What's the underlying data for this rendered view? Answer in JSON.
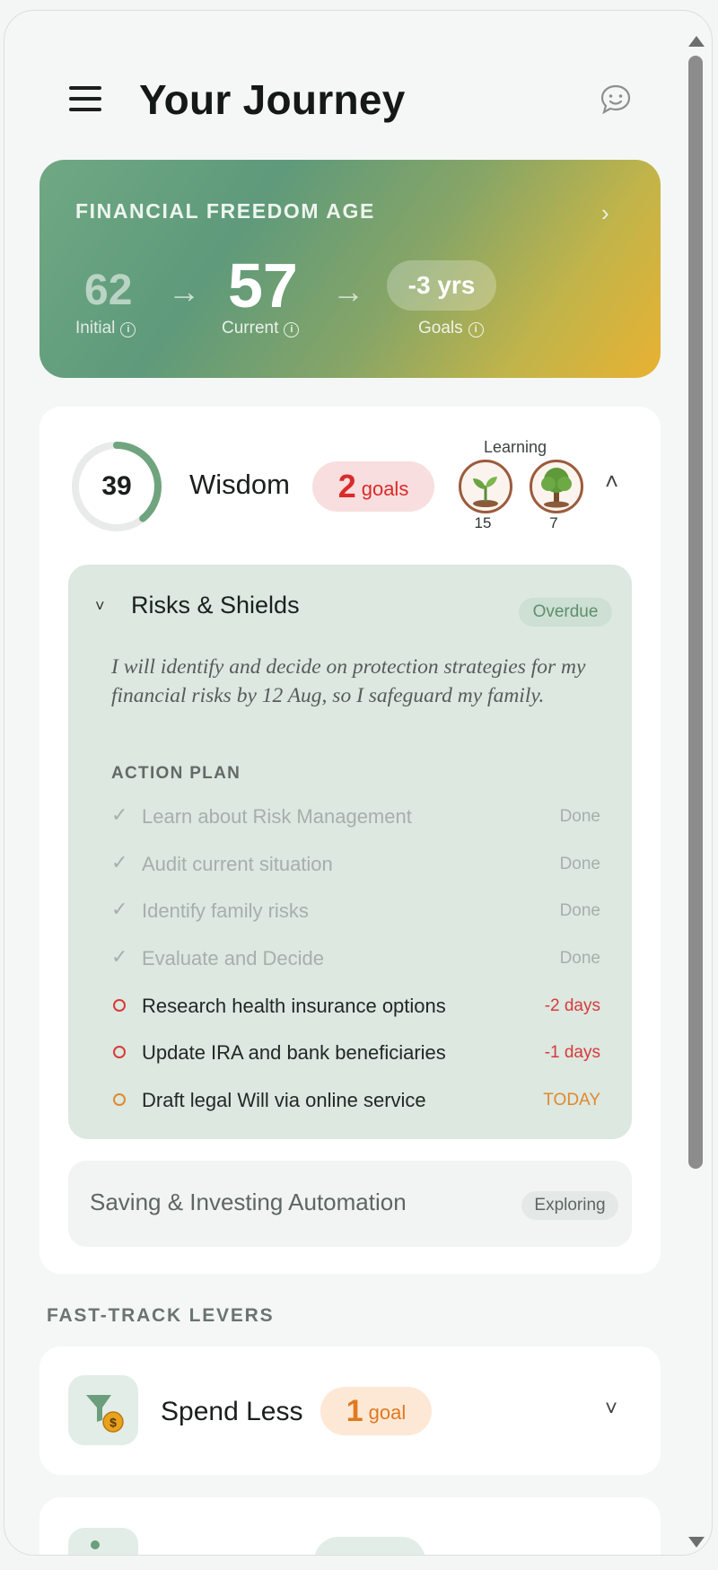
{
  "header": {
    "title": "Your Journey",
    "menu_icon": "menu-icon",
    "chat_icon": "chat-icon"
  },
  "freedom": {
    "title": "FINANCIAL FREEDOM AGE",
    "initial_value": "62",
    "initial_label": "Initial",
    "current_value": "57",
    "current_label": "Current",
    "goals_delta": "-3 yrs",
    "goals_label": "Goals",
    "colors": {
      "start": "#6fa883",
      "end": "#e8b232"
    }
  },
  "wisdom": {
    "score": "39",
    "score_fraction": 0.39,
    "title": "Wisdom",
    "goals_count": "2",
    "goals_word": "goals",
    "learning_label": "Learning",
    "badges": [
      {
        "icon": "sprout-icon",
        "count": "15"
      },
      {
        "icon": "tree-icon",
        "count": "7"
      }
    ]
  },
  "risks": {
    "title": "Risks & Shields",
    "status": "Overdue",
    "description": "I will identify and decide on protection strategies for my financial risks by 12 Aug, so I safeguard my family.",
    "action_plan_label": "ACTION PLAN",
    "tasks": [
      {
        "label": "Learn about Risk Management",
        "status": "Done"
      },
      {
        "label": "Audit current situation",
        "status": "Done"
      },
      {
        "label": "Identify family risks",
        "status": "Done"
      },
      {
        "label": "Evaluate and Decide",
        "status": "Done"
      },
      {
        "label": "Research health insurance options",
        "status": "-2 days"
      },
      {
        "label": "Update IRA and bank beneficiaries",
        "status": "-1 days"
      },
      {
        "label": "Draft legal Will via online service",
        "status": "TODAY"
      }
    ]
  },
  "saving": {
    "title": "Saving & Investing Automation",
    "status": "Exploring"
  },
  "fast_track": {
    "label": "FAST-TRACK LEVERS",
    "spend": {
      "title": "Spend Less",
      "goals_count": "1",
      "goals_word": "goal"
    }
  }
}
